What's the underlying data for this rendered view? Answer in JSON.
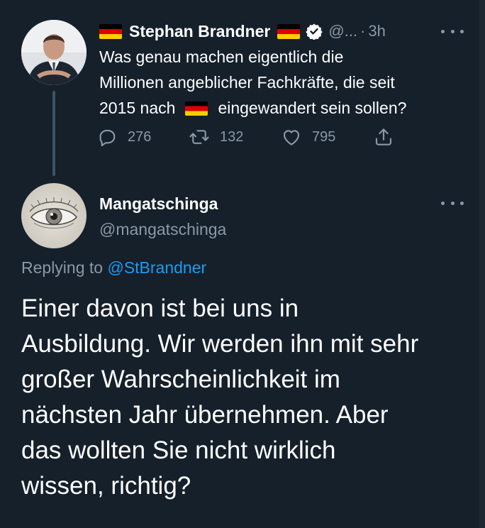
{
  "parent_tweet": {
    "author_name": "Stephan Brandner",
    "handle": "@...",
    "separator": "·",
    "time": "3h",
    "text_line1": "Was genau machen eigentlich die",
    "text_line2": "Millionen angeblicher Fachkräfte, die seit",
    "text_line3_before_flag": "2015 nach",
    "text_line3_after_flag": "eingewandert sein sollen?",
    "actions": {
      "replies": "276",
      "retweets": "132",
      "likes": "795"
    },
    "icons": [
      "german-flag-icon",
      "verified-badge-icon",
      "more-options-icon",
      "reply-icon",
      "retweet-icon",
      "like-icon",
      "share-icon"
    ]
  },
  "reply_tweet": {
    "author_name": "Mangatschinga",
    "handle": "@mangatschinga",
    "replying_prefix": "Replying to",
    "replying_to": "@StBrandner",
    "text_lines": [
      "Einer davon ist bei uns in",
      "Ausbildung. Wir werden ihn mit sehr",
      "großer Wahrscheinlichkeit im",
      "nächsten Jahr übernehmen. Aber",
      "das wollten Sie nicht wirklich",
      "wissen, richtig?"
    ]
  },
  "colors": {
    "background": "#15202b",
    "primary_text": "#ffffff",
    "secondary_text": "#8b98a5",
    "link": "#1d9bf0",
    "thread_line": "#3d5466"
  }
}
